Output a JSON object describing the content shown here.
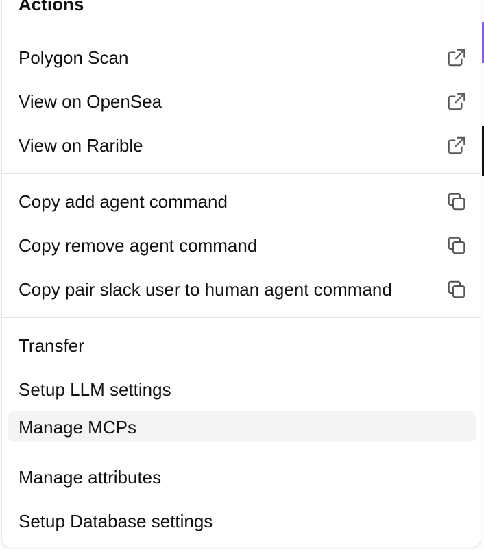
{
  "menu": {
    "header": "Actions",
    "groups": [
      {
        "items": [
          {
            "label": "Polygon Scan",
            "icon": "external-link-icon"
          },
          {
            "label": "View on OpenSea",
            "icon": "external-link-icon"
          },
          {
            "label": "View on Rarible",
            "icon": "external-link-icon"
          }
        ]
      },
      {
        "items": [
          {
            "label": "Copy add agent command",
            "icon": "copy-icon"
          },
          {
            "label": "Copy remove agent command",
            "icon": "copy-icon"
          },
          {
            "label": "Copy pair slack user to human agent command",
            "icon": "copy-icon"
          }
        ]
      },
      {
        "items": [
          {
            "label": "Transfer"
          },
          {
            "label": "Setup LLM settings"
          },
          {
            "label": "Manage MCPs",
            "state": "hovered"
          },
          {
            "label": "Manage attributes"
          },
          {
            "label": "Setup Database settings"
          }
        ]
      }
    ],
    "colors": {
      "text": "#111111",
      "icon": "#555555",
      "hover_bg": "#f4f4f4",
      "divider": "#e5e5e5"
    }
  }
}
